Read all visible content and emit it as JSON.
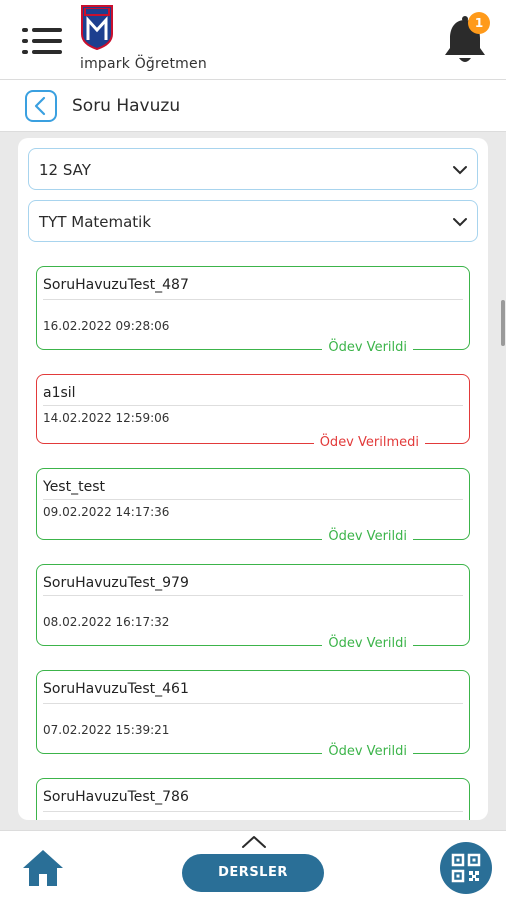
{
  "header": {
    "brand": "impark Öğretmen",
    "notification_count": "1",
    "icons": {
      "menu": "menu-icon",
      "logo": "school-logo",
      "bell": "bell-icon"
    },
    "colors": {
      "badge": "#ff9a1a"
    }
  },
  "titlebar": {
    "title": "Soru Havuzu",
    "back_icon": "chevron-left-icon",
    "accent": "#3aa0e0"
  },
  "filters": {
    "class_select": "12 SAY",
    "lesson_select": "TYT Matematik"
  },
  "assignments": [
    {
      "name": "SoruHavuzuTest_487",
      "date": "16.02.2022 09:28:06",
      "status": "Ödev Verildi"
    },
    {
      "name": "a1sil",
      "date": "14.02.2022 12:59:06",
      "status": "Ödev Verilmedi"
    },
    {
      "name": "Yest_test",
      "date": "09.02.2022 14:17:36",
      "status": "Ödev Verildi"
    },
    {
      "name": "SoruHavuzuTest_979",
      "date": "08.02.2022 16:17:32",
      "status": "Ödev Verildi"
    },
    {
      "name": "SoruHavuzuTest_461",
      "date": "07.02.2022 15:39:21",
      "status": "Ödev Verildi"
    },
    {
      "name": "SoruHavuzuTest_786"
    }
  ],
  "status_colors": {
    "given": "#3cb44a",
    "not_given": "#e23a3a"
  },
  "bottombar": {
    "dersler_label": "DERSLER",
    "icons": {
      "home": "home-icon",
      "up": "chevron-up-icon",
      "qr": "qr-code-icon"
    },
    "colors": {
      "primary": "#2a6f97"
    }
  }
}
